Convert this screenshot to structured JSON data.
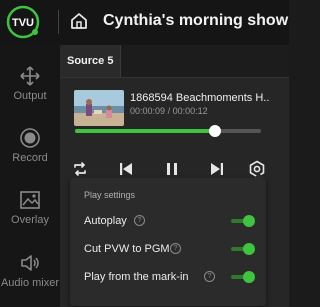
{
  "app": {
    "logo_text": "TVU",
    "title": "Cynthia's morning show"
  },
  "sidebar": {
    "items": [
      {
        "label": "Output",
        "icon": "output-icon"
      },
      {
        "label": "Record",
        "icon": "record-icon"
      },
      {
        "label": "Overlay",
        "icon": "overlay-icon"
      },
      {
        "label": "Audio mixer",
        "icon": "speaker-icon"
      }
    ]
  },
  "source": {
    "tab_label": "Source 5",
    "clip_name": "1868594 Beachmoments H..",
    "elapsed": "00:00:09",
    "separator": "/",
    "duration": "00:00:12",
    "progress_fraction": 0.75
  },
  "controls": [
    "loop-icon",
    "previous-icon",
    "pause-icon",
    "next-icon",
    "settings-icon"
  ],
  "play_settings": {
    "title": "Play settings",
    "options": [
      {
        "label": "Autoplay",
        "enabled": true
      },
      {
        "label": "Cut PVW to PGM",
        "enabled": true
      },
      {
        "label": "Play from the mark-in",
        "enabled": true
      }
    ]
  },
  "colors": {
    "accent": "#3ec43e",
    "background": "#1b1b1b",
    "panel": "#262626"
  }
}
